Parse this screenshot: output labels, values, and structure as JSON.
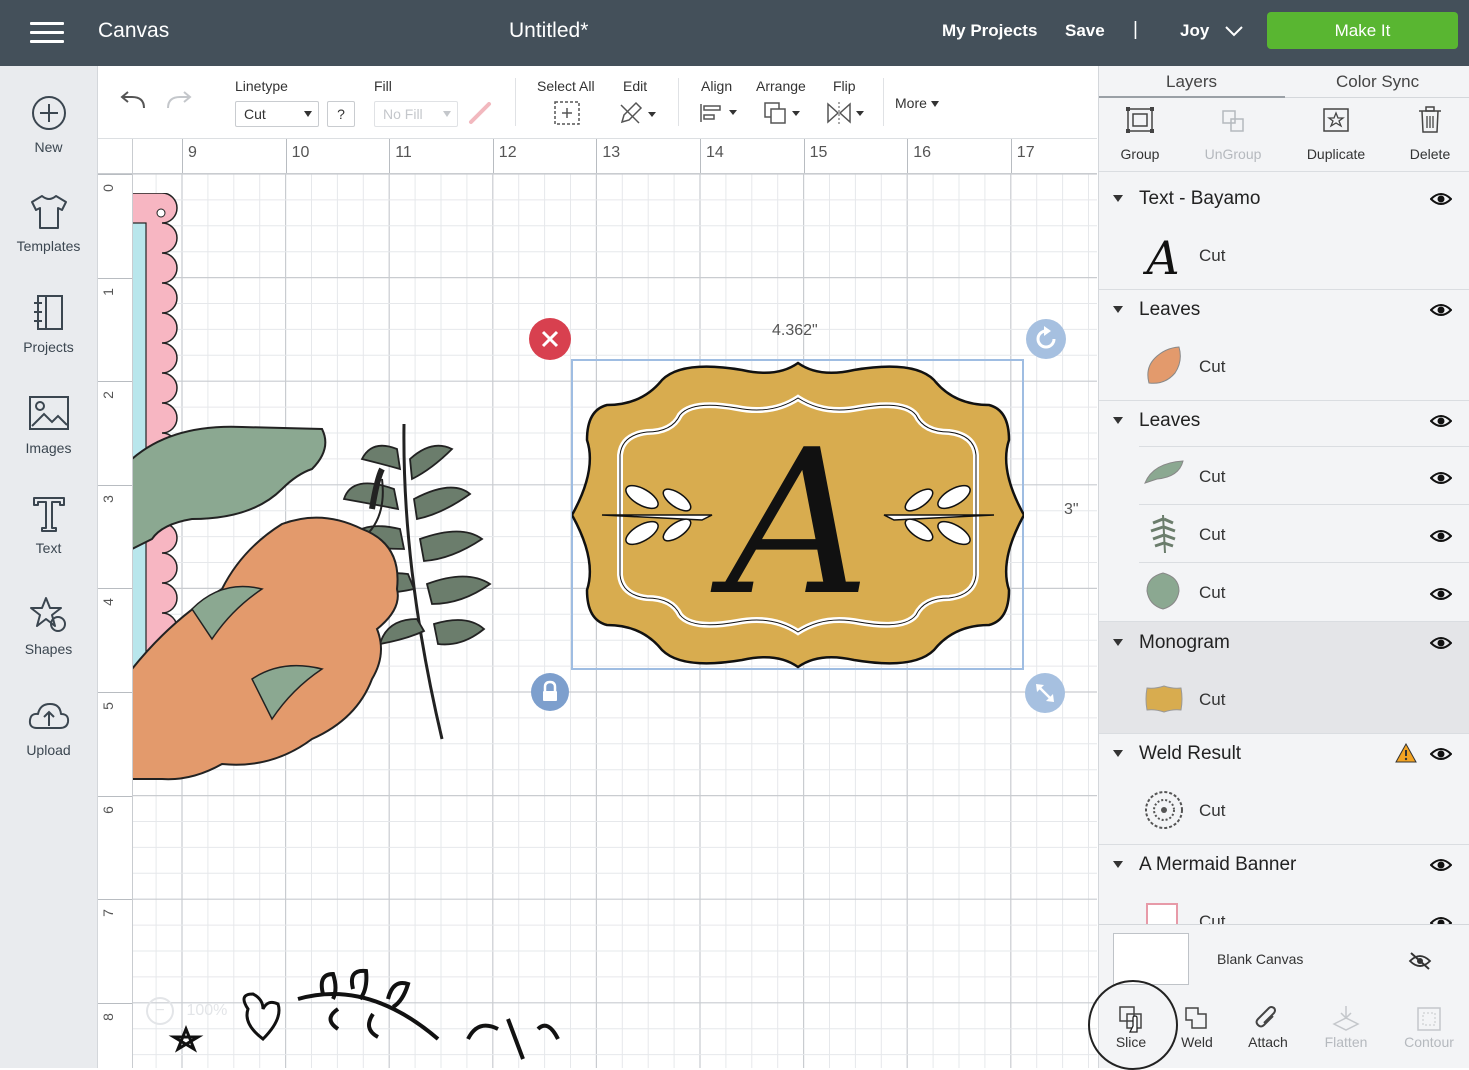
{
  "topbar": {
    "app_title": "Canvas",
    "doc_title": "Untitled*",
    "my_projects": "My Projects",
    "save": "Save",
    "separator": "|",
    "user": "Joy",
    "make_it": "Make It"
  },
  "sidebar": {
    "items": [
      {
        "label": "New",
        "icon": "plus-circle-icon"
      },
      {
        "label": "Templates",
        "icon": "tshirt-icon"
      },
      {
        "label": "Projects",
        "icon": "notebook-icon"
      },
      {
        "label": "Images",
        "icon": "image-icon"
      },
      {
        "label": "Text",
        "icon": "text-icon"
      },
      {
        "label": "Shapes",
        "icon": "shapes-icon"
      },
      {
        "label": "Upload",
        "icon": "cloud-upload-icon"
      }
    ]
  },
  "toolbar": {
    "linetype_label": "Linetype",
    "linetype_value": "Cut",
    "help": "?",
    "fill_label": "Fill",
    "fill_value": "No Fill",
    "select_all": "Select All",
    "edit": "Edit",
    "align": "Align",
    "arrange": "Arrange",
    "flip": "Flip",
    "more": "More"
  },
  "canvas": {
    "hruler": [
      "9",
      "10",
      "11",
      "12",
      "13",
      "14",
      "15",
      "16",
      "17"
    ],
    "vruler": [
      "0",
      "1",
      "2",
      "3",
      "4",
      "5",
      "6",
      "7",
      "8"
    ],
    "width_label": "4.362\"",
    "height_label": "3\"",
    "zoom": "100%",
    "monogram_letter": "A"
  },
  "panel": {
    "tabs": [
      "Layers",
      "Color Sync"
    ],
    "actions": [
      {
        "label": "Group",
        "enabled": true
      },
      {
        "label": "UnGroup",
        "enabled": false
      },
      {
        "label": "Duplicate",
        "enabled": true
      },
      {
        "label": "Delete",
        "enabled": true
      }
    ],
    "layers": [
      {
        "name": "Text - Bayamo",
        "children": [
          "Cut"
        ]
      },
      {
        "name": "Leaves",
        "children": [
          "Cut"
        ]
      },
      {
        "name": "Leaves",
        "children": [
          "Cut",
          "Cut",
          "Cut"
        ]
      },
      {
        "name": "Monogram",
        "children": [
          "Cut"
        ],
        "selected": true
      },
      {
        "name": "Weld Result",
        "children": [
          "Cut"
        ],
        "warning": true
      },
      {
        "name": "A Mermaid Banner",
        "children": [
          "Cut"
        ]
      }
    ],
    "blank_canvas": "Blank Canvas",
    "bottom_actions": [
      {
        "label": "Slice",
        "enabled": true
      },
      {
        "label": "Weld",
        "enabled": true
      },
      {
        "label": "Attach",
        "enabled": true
      },
      {
        "label": "Flatten",
        "enabled": false
      },
      {
        "label": "Contour",
        "enabled": false
      }
    ]
  },
  "colors": {
    "topbar": "#44505a",
    "make_it": "#59b631",
    "monogram": "#d8ac4f",
    "leaf_orange": "#e39a6c",
    "leaf_green": "#8aa48b",
    "selection": "#8fb1dc",
    "delete_handle": "#d8404f"
  }
}
